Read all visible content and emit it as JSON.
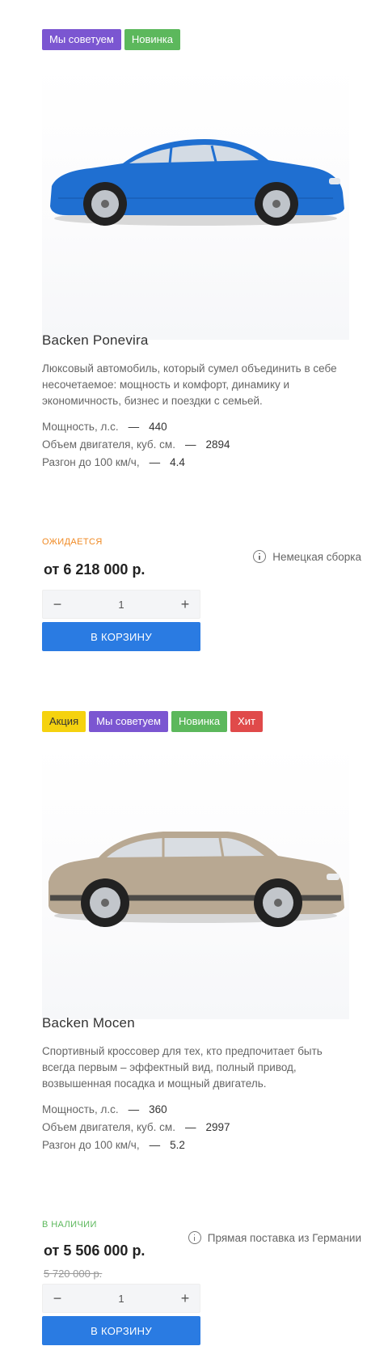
{
  "products": [
    {
      "badges": [
        "Мы советуем",
        "Новинка"
      ],
      "title": "Backen Ponevira",
      "description": "Люксовый автомобиль, который сумел объединить в себе несочетаемое: мощность и комфорт, динамику и экономичность, бизнес и поездки с семьей.",
      "props": [
        {
          "label": "Мощность, л.с.",
          "sep": "—",
          "value": "440"
        },
        {
          "label": "Объем двигателя, куб. см.",
          "sep": "—",
          "value": "2894"
        },
        {
          "label": "Разгон до 100 км/ч,",
          "sep": "—",
          "value": "4.4"
        }
      ],
      "status": "ОЖИДАЕТСЯ",
      "price": "от 6 218 000 р.",
      "note": "Немецкая сборка",
      "quantity": "1",
      "cart_label": "В КОРЗИНУ",
      "car_color": "#1f6fd1"
    },
    {
      "badges": [
        "Акция",
        "Мы советуем",
        "Новинка",
        "Хит"
      ],
      "title": "Backen Mocen",
      "description": "Спортивный кроссовер для тех, кто предпочитает быть всегда первым – эффектный вид, полный привод, возвышенная посадка и мощный двигатель.",
      "props": [
        {
          "label": "Мощность, л.с.",
          "sep": "—",
          "value": "360"
        },
        {
          "label": "Объем двигателя, куб. см.",
          "sep": "—",
          "value": "2997"
        },
        {
          "label": "Разгон до 100 км/ч,",
          "sep": "—",
          "value": "5.2"
        }
      ],
      "status": "В НАЛИЧИИ",
      "price": "от 5 506 000 р.",
      "old_price": "5 720 000 р.",
      "note": "Прямая поставка из Германии",
      "quantity": "1",
      "cart_label": "В КОРЗИНУ",
      "car_color": "#b8a892"
    }
  ]
}
